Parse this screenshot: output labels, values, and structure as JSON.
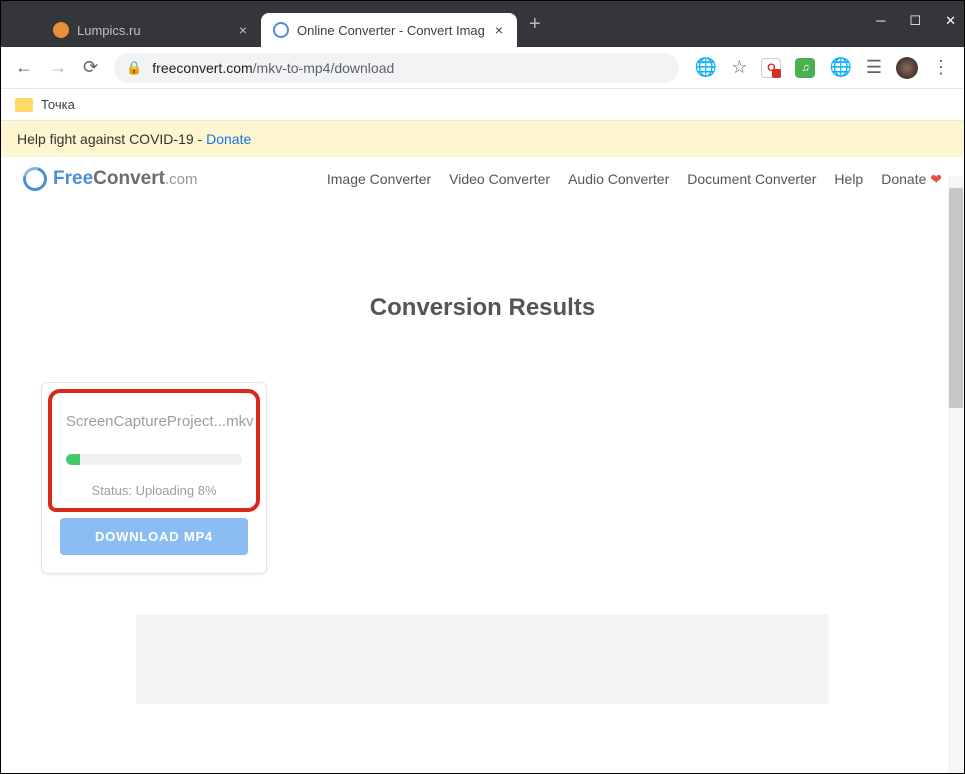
{
  "browser": {
    "tabs": [
      {
        "title": "Lumpics.ru"
      },
      {
        "title": "Online Converter - Convert Imag"
      }
    ],
    "url_host": "freeconvert.com",
    "url_path": "/mkv-to-mp4/download",
    "bookmark": "Точка"
  },
  "covid": {
    "text": "Help fight against COVID-19 - ",
    "link": "Donate"
  },
  "logo": {
    "free": "Free",
    "convert": "Convert",
    "com": ".com"
  },
  "nav": {
    "image": "Image Converter",
    "video": "Video Converter",
    "audio": "Audio Converter",
    "document": "Document Converter",
    "help": "Help",
    "donate": "Donate"
  },
  "heading": "Conversion Results",
  "card": {
    "filename": "ScreenCaptureProject...mkv",
    "status": "Status: Uploading 8%",
    "button": "DOWNLOAD MP4"
  }
}
